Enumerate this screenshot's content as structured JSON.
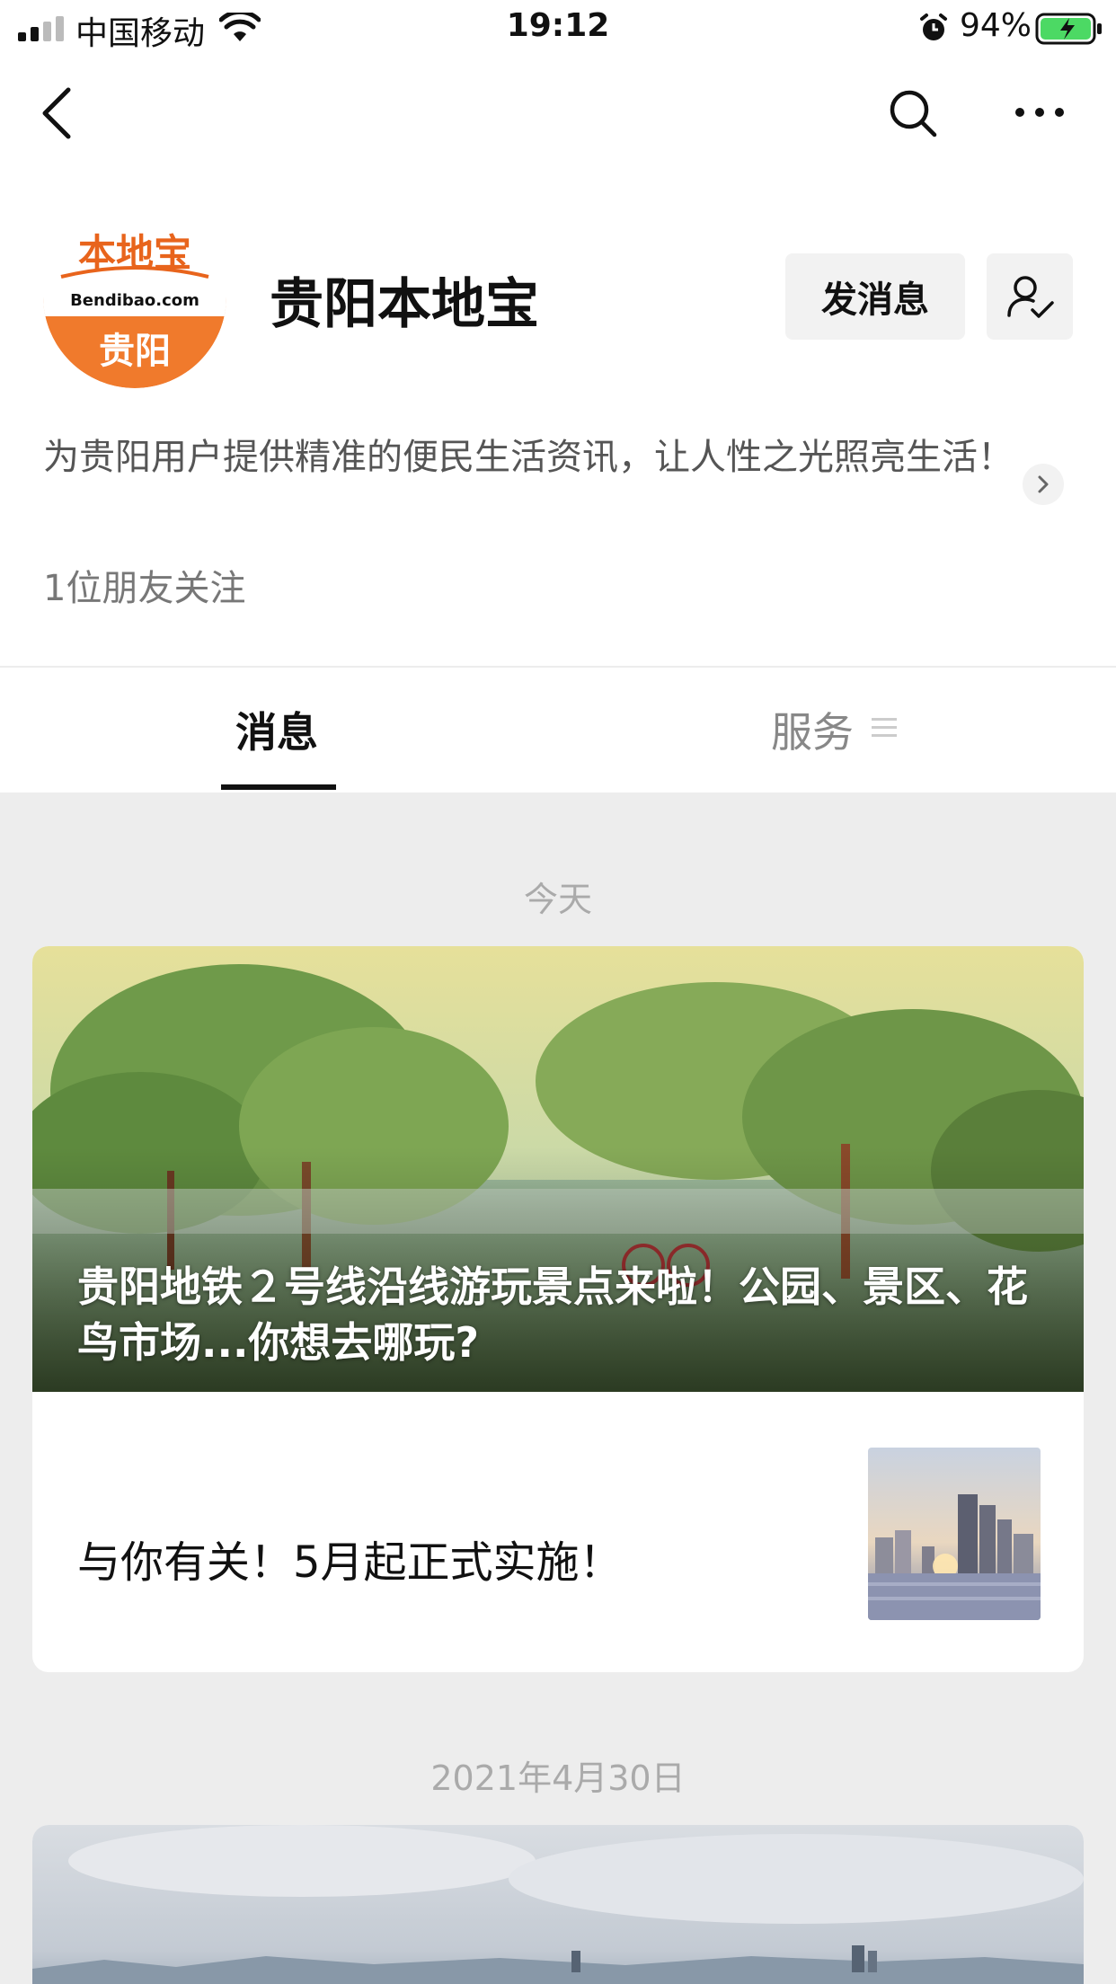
{
  "status_bar": {
    "carrier": "中国移动",
    "time": "19:12",
    "battery": "94%"
  },
  "account": {
    "logo_text": "本地宝",
    "logo_domain": "Bendibao.com",
    "logo_city": "贵阳",
    "name": "贵阳本地宝",
    "message_button": "发消息",
    "description": "为贵阳用户提供精准的便民生活资讯，让人性之光照亮生活！",
    "followers": "1位朋友关注"
  },
  "tabs": {
    "messages": "消息",
    "services": "服务"
  },
  "feed": [
    {
      "date": "今天",
      "hero_title": "贵阳地铁２号线沿线游玩景点来啦！公园、景区、花鸟市场...你想去哪玩?",
      "sub_title": "与你有关！5月起正式实施！"
    },
    {
      "date": "2021年4月30日"
    }
  ],
  "colors": {
    "logo_orange": "#f07a2c",
    "battery_green": "#4cd964"
  }
}
